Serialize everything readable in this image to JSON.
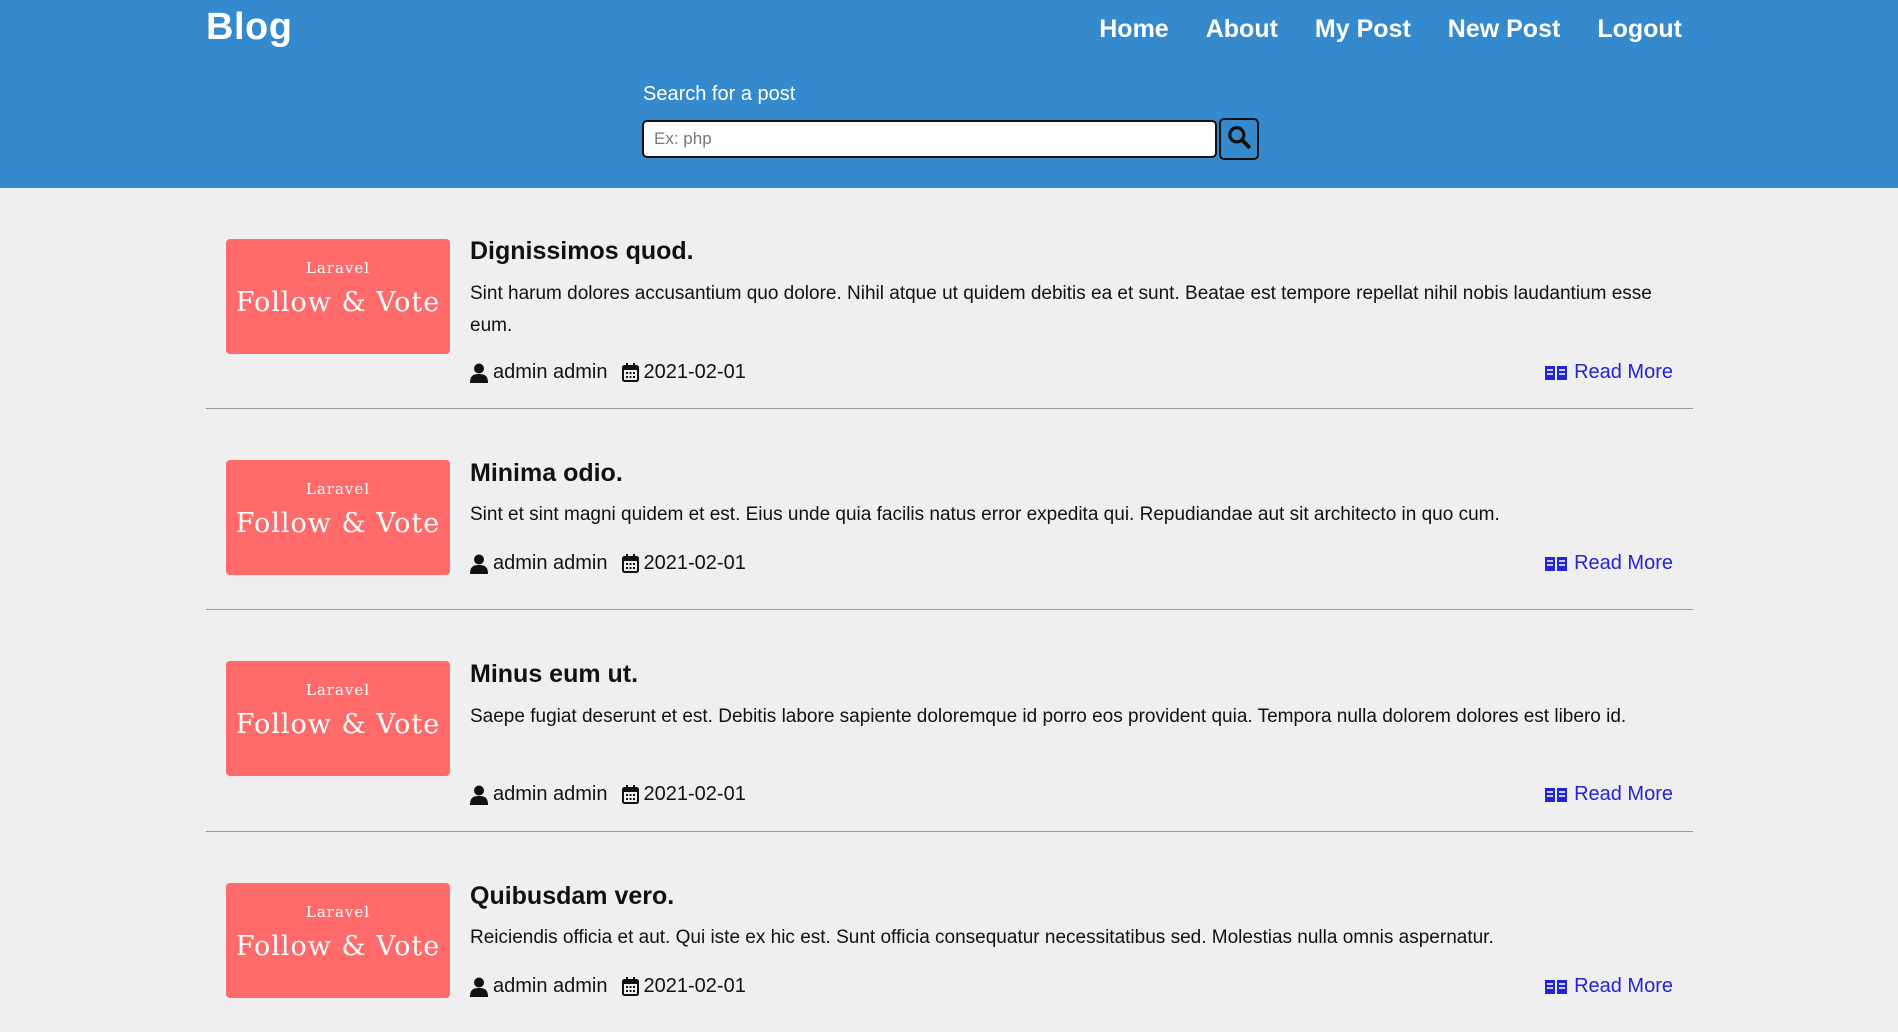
{
  "header": {
    "brand": "Blog",
    "nav": [
      "Home",
      "About",
      "My Post",
      "New Post",
      "Logout"
    ]
  },
  "search": {
    "label": "Search for a post",
    "placeholder": "Ex: php",
    "value": ""
  },
  "thumbnail": {
    "small_text": "Laravel",
    "big_text": "Follow & Vote"
  },
  "posts": [
    {
      "title": "Dignissimos quod.",
      "excerpt": "Sint harum dolores accusantium quo dolore. Nihil atque ut quidem debitis ea et sunt. Beatae est tempore repellat nihil nobis laudantium esse eum.",
      "author": "admin admin",
      "date": "2021-02-01",
      "read_more": "Read More"
    },
    {
      "title": "Minima odio.",
      "excerpt": "Sint et sint magni quidem et est. Eius unde quia facilis natus error expedita qui. Repudiandae aut sit architecto in quo cum.",
      "author": "admin admin",
      "date": "2021-02-01",
      "read_more": "Read More"
    },
    {
      "title": "Minus eum ut.",
      "excerpt": "Saepe fugiat deserunt et est. Debitis labore sapiente doloremque id porro eos provident quia. Tempora nulla dolorem dolores est libero id.",
      "author": "admin admin",
      "date": "2021-02-01",
      "read_more": "Read More"
    },
    {
      "title": "Quibusdam vero.",
      "excerpt": "Reiciendis officia et aut. Qui iste ex hic est. Sunt officia consequatur necessitatibus sed. Molestias nulla omnis aspernatur.",
      "author": "admin admin",
      "date": "2021-02-01",
      "read_more": "Read More"
    }
  ],
  "colors": {
    "header_bg": "#3589cd",
    "thumbnail_bg": "#ff6b6b",
    "link": "#2323d8",
    "page_bg": "#efefef"
  },
  "icons": [
    "search-icon",
    "user-icon",
    "calendar-icon",
    "book-open-icon"
  ]
}
